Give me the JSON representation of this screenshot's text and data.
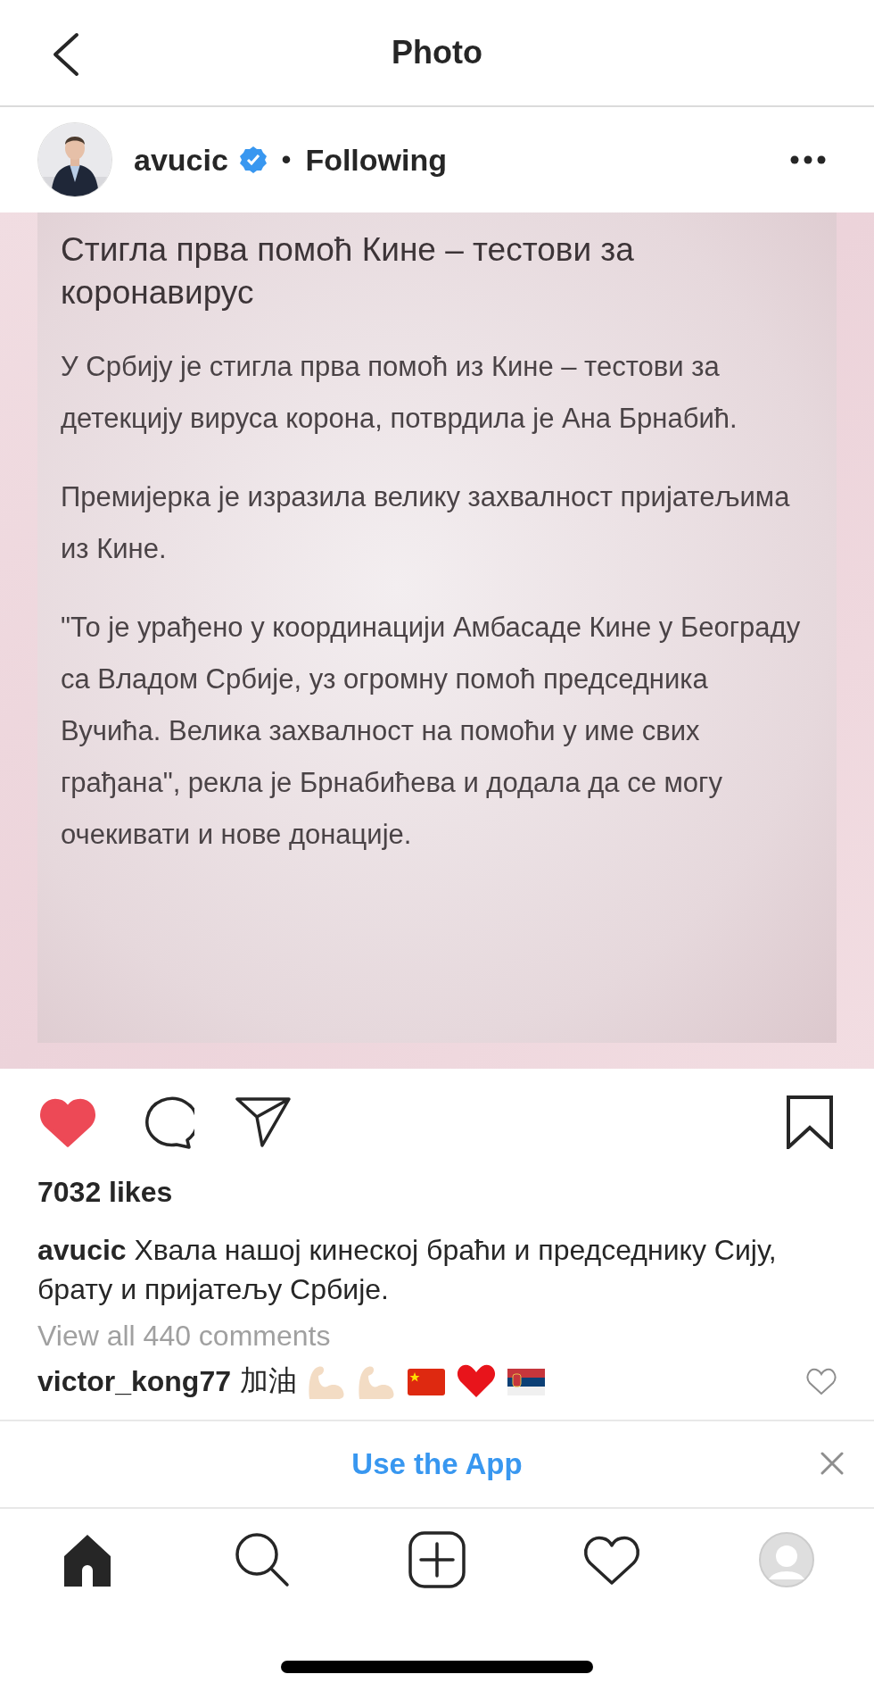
{
  "header": {
    "title": "Photo"
  },
  "post": {
    "username": "avucic",
    "verified": true,
    "separator": "•",
    "follow_label": "Following"
  },
  "image": {
    "heading": "Стигла прва помоћ Кине – тестови за коронавирус",
    "paragraphs": [
      "У Србију је стигла прва помоћ из Кине – тестови за детекцију вируса корона, потврдила је Ана Брнабић.",
      "Премијерка је изразила велику захвалност пријатељима из Кине.",
      "\"То је урађено у координацији Амбасаде Кине у Београду са Владом Србије, уз огромну помоћ председника Вучића. Велика захвалност на помоћи у име свих грађана\", рекла је Брнабићева и додала да се могу очекивати и нове донације."
    ]
  },
  "actions": {
    "liked": true,
    "saved": false
  },
  "likes": "7032 likes",
  "caption": {
    "username": "avucic",
    "text": "Хвала нашој кинеској браћи и председнику Сију, брату и пријатељу Србије."
  },
  "view_comments": "View all 440 comments",
  "comments": [
    {
      "username": "victor_kong77",
      "text": "加油",
      "liked": false
    }
  ],
  "banner": {
    "label": "Use the App"
  },
  "nav": [
    {
      "kind": "home",
      "selected": true
    },
    {
      "kind": "search",
      "selected": false
    },
    {
      "kind": "add",
      "selected": false
    },
    {
      "kind": "activity",
      "selected": false
    },
    {
      "kind": "profile",
      "selected": false
    }
  ]
}
